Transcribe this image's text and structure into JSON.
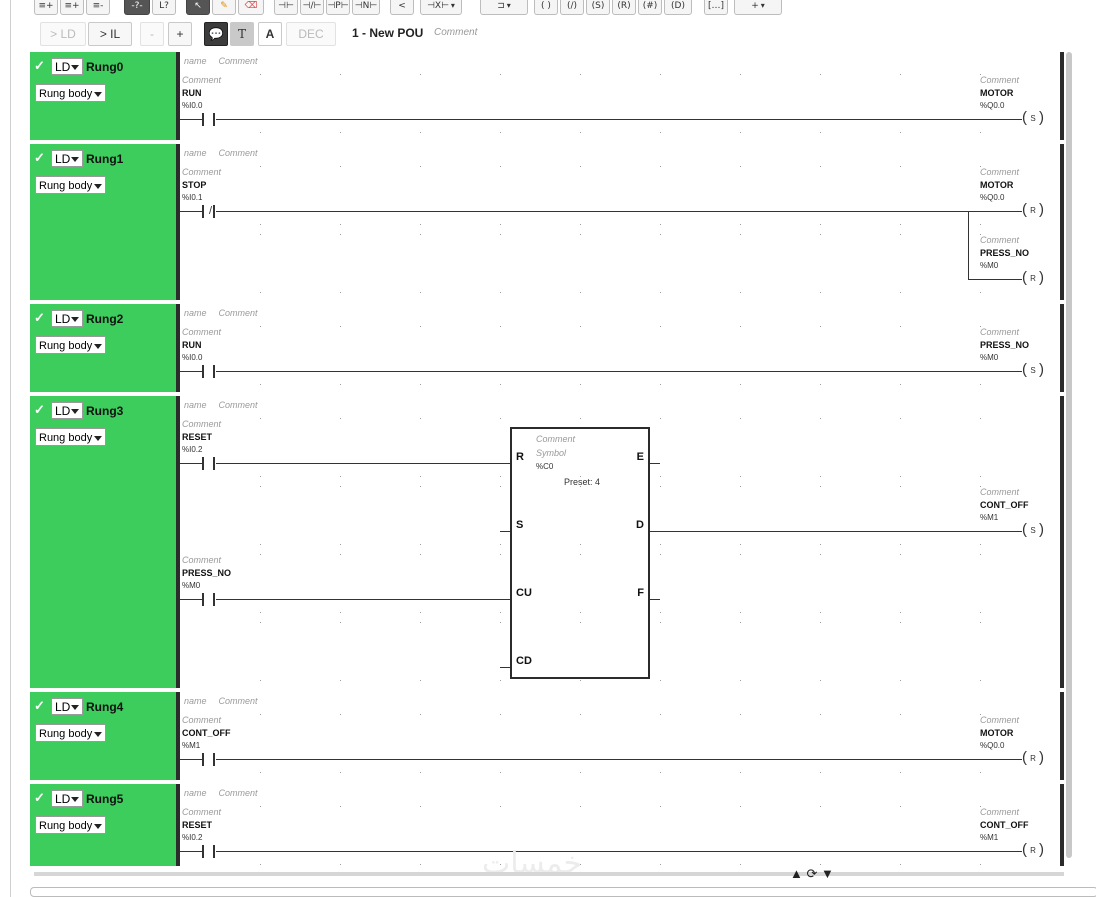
{
  "toolbar": {
    "icons": [
      "insert-rung-icon",
      "insert-rung-after-icon",
      "delete-rung-icon",
      "branch-icon",
      "link-icon",
      "select-icon",
      "pencil-icon",
      "eraser-icon",
      "contact-no-icon",
      "contact-nc-icon",
      "contact-rising-icon",
      "contact-falling-icon",
      "compare-icon",
      "function-block-icon",
      "box-icon",
      "coil-icon",
      "negated-coil-icon",
      "set-coil-icon",
      "reset-coil-icon",
      "rising-coil-icon",
      "falling-coil-icon",
      "operate-block-icon",
      "add-icon"
    ],
    "buttons": {
      "to_ld": "> LD",
      "to_il": "> IL",
      "minus": "-",
      "plus": "+",
      "dec": "DEC"
    },
    "pou_title": "1 - New POU",
    "pou_comment": "Comment"
  },
  "labels": {
    "name": "name",
    "comment": "Comment",
    "rung_body": "Rung body",
    "ld": "LD"
  },
  "rungs": [
    {
      "name": "Rung0",
      "contact": {
        "comment": "Comment",
        "var": "RUN",
        "addr": "%I0.0",
        "type": "NO"
      },
      "coils": [
        {
          "comment": "Comment",
          "var": "MOTOR",
          "addr": "%Q0.0",
          "type": "S"
        }
      ]
    },
    {
      "name": "Rung1",
      "contact": {
        "comment": "Comment",
        "var": "STOP",
        "addr": "%I0.1",
        "type": "NC"
      },
      "coils": [
        {
          "comment": "Comment",
          "var": "MOTOR",
          "addr": "%Q0.0",
          "type": "R"
        },
        {
          "comment": "Comment",
          "var": "PRESS_NO",
          "addr": "%M0",
          "type": "R"
        }
      ]
    },
    {
      "name": "Rung2",
      "contact": {
        "comment": "Comment",
        "var": "RUN",
        "addr": "%I0.0",
        "type": "NO"
      },
      "coils": [
        {
          "comment": "Comment",
          "var": "PRESS_NO",
          "addr": "%M0",
          "type": "S"
        }
      ]
    },
    {
      "name": "Rung3",
      "contacts": [
        {
          "comment": "Comment",
          "var": "RESET",
          "addr": "%I0.2"
        },
        {
          "comment": "Comment",
          "var": "PRESS_NO",
          "addr": "%M0"
        }
      ],
      "counter": {
        "comment": "Comment",
        "symbol": "Symbol",
        "addr": "%C0",
        "preset": "Preset: 4",
        "pins": {
          "r": "R",
          "s": "S",
          "cu": "CU",
          "cd": "CD",
          "e": "E",
          "d": "D",
          "f": "F"
        }
      },
      "coils": [
        {
          "comment": "Comment",
          "var": "CONT_OFF",
          "addr": "%M1",
          "type": "S"
        }
      ]
    },
    {
      "name": "Rung4",
      "contact": {
        "comment": "Comment",
        "var": "CONT_OFF",
        "addr": "%M1",
        "type": "NO"
      },
      "coils": [
        {
          "comment": "Comment",
          "var": "MOTOR",
          "addr": "%Q0.0",
          "type": "R"
        }
      ]
    },
    {
      "name": "Rung5",
      "contact": {
        "comment": "Comment",
        "var": "RESET",
        "addr": "%I0.2",
        "type": "NO"
      },
      "coils": [
        {
          "comment": "Comment",
          "var": "CONT_OFF",
          "addr": "%M1",
          "type": "R"
        }
      ]
    }
  ],
  "footer": {
    "watermark": "خمسات",
    "nav": [
      "up-arrow-icon",
      "refresh-icon",
      "down-arrow-icon"
    ]
  }
}
